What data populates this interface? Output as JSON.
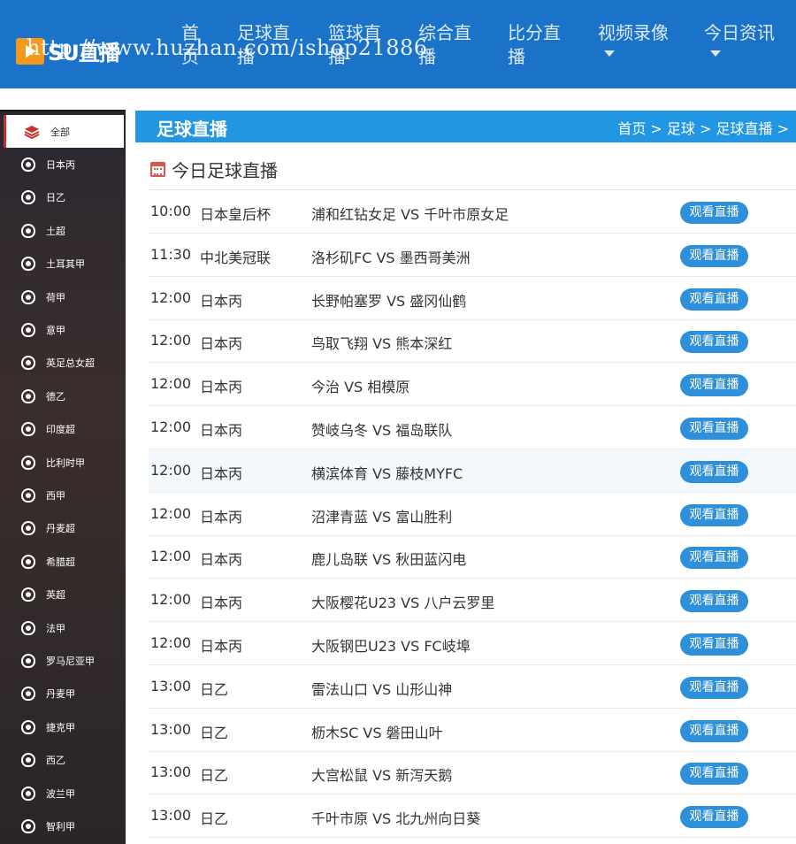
{
  "header": {
    "logo_text": "SU直播",
    "watermark": "http://www.huzhan.com/ishop21886",
    "nav": [
      {
        "label": "首页",
        "dropdown": false
      },
      {
        "label": "足球直播",
        "dropdown": false
      },
      {
        "label": "篮球直播",
        "dropdown": false
      },
      {
        "label": "综合直播",
        "dropdown": false
      },
      {
        "label": "比分直播",
        "dropdown": false
      },
      {
        "label": "视频录像",
        "dropdown": true
      },
      {
        "label": "今日资讯",
        "dropdown": true
      }
    ]
  },
  "sidebar": {
    "items": [
      {
        "label": "全部",
        "icon": "layers-icon",
        "active": true
      },
      {
        "label": "日本丙",
        "icon": "league-badge-icon"
      },
      {
        "label": "日乙",
        "icon": "league-badge-icon"
      },
      {
        "label": "土超",
        "icon": "league-badge-icon"
      },
      {
        "label": "土耳其甲",
        "icon": "league-badge-icon"
      },
      {
        "label": "荷甲",
        "icon": "league-badge-icon"
      },
      {
        "label": "意甲",
        "icon": "league-badge-icon"
      },
      {
        "label": "英足总女超",
        "icon": "league-badge-icon"
      },
      {
        "label": "德乙",
        "icon": "league-badge-icon"
      },
      {
        "label": "印度超",
        "icon": "league-badge-icon"
      },
      {
        "label": "比利时甲",
        "icon": "league-badge-icon"
      },
      {
        "label": "西甲",
        "icon": "league-badge-icon"
      },
      {
        "label": "丹麦超",
        "icon": "league-badge-icon"
      },
      {
        "label": "希腊超",
        "icon": "league-badge-icon"
      },
      {
        "label": "英超",
        "icon": "league-badge-icon"
      },
      {
        "label": "法甲",
        "icon": "league-badge-icon"
      },
      {
        "label": "罗马尼亚甲",
        "icon": "league-badge-icon"
      },
      {
        "label": "丹麦甲",
        "icon": "league-badge-icon"
      },
      {
        "label": "捷克甲",
        "icon": "league-badge-icon"
      },
      {
        "label": "西乙",
        "icon": "league-badge-icon"
      },
      {
        "label": "波兰甲",
        "icon": "league-badge-icon"
      },
      {
        "label": "智利甲",
        "icon": "league-badge-icon"
      }
    ]
  },
  "main": {
    "title": "足球直播",
    "breadcrumb": "首页 > 足球 > 足球直播 >",
    "subtitle": "今日足球直播",
    "watch_label": "观看直播",
    "matches": [
      {
        "time": "10:00",
        "league": "日本皇后杯",
        "match": "浦和红钻女足 VS 千叶市原女足"
      },
      {
        "time": "11:30",
        "league": "中北美冠联",
        "match": "洛杉矶FC VS 墨西哥美洲"
      },
      {
        "time": "12:00",
        "league": "日本丙",
        "match": "长野帕塞罗 VS 盛冈仙鹤"
      },
      {
        "time": "12:00",
        "league": "日本丙",
        "match": "鸟取飞翔 VS 熊本深红"
      },
      {
        "time": "12:00",
        "league": "日本丙",
        "match": "今治 VS 相模原"
      },
      {
        "time": "12:00",
        "league": "日本丙",
        "match": "赞岐乌冬 VS 福岛联队"
      },
      {
        "time": "12:00",
        "league": "日本丙",
        "match": "横滨体育 VS 藤枝MYFC",
        "highlight": true
      },
      {
        "time": "12:00",
        "league": "日本丙",
        "match": "沼津青蓝 VS 富山胜利"
      },
      {
        "time": "12:00",
        "league": "日本丙",
        "match": "鹿儿岛联 VS 秋田蓝闪电"
      },
      {
        "time": "12:00",
        "league": "日本丙",
        "match": "大阪樱花U23 VS 八户云罗里"
      },
      {
        "time": "12:00",
        "league": "日本丙",
        "match": "大阪钢巴U23 VS FC岐埠"
      },
      {
        "time": "13:00",
        "league": "日乙",
        "match": "雷法山口 VS 山形山神"
      },
      {
        "time": "13:00",
        "league": "日乙",
        "match": "枥木SC VS 磐田山叶"
      },
      {
        "time": "13:00",
        "league": "日乙",
        "match": "大宫松鼠 VS 新泻天鹅"
      },
      {
        "time": "13:00",
        "league": "日乙",
        "match": "千叶市原 VS 北九州向日葵"
      }
    ]
  },
  "colors": {
    "header_bg": "#1a73c9",
    "title_bar": "#2196e3",
    "watch_button": "#2e8fdb",
    "logo_orange": "#f39a1e"
  }
}
